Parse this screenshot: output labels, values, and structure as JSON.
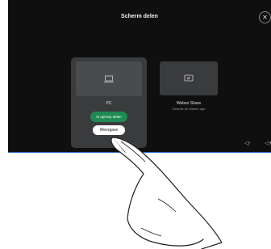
{
  "header": {
    "title": "Scherm delen",
    "close_icon": "close-icon"
  },
  "sources": [
    {
      "label": "PC",
      "subtitle": "",
      "icon": "laptop-icon",
      "selected": true
    },
    {
      "label": "Webex Share",
      "subtitle": "Gebruik de Webex-app",
      "icon": "cast-screen-icon",
      "selected": false
    }
  ],
  "actions": {
    "share_in_call": "In oproep delen",
    "preview": "Weergave"
  },
  "volume": {
    "down_icon": "volume-down-icon",
    "up_icon": "volume-up-icon"
  },
  "colors": {
    "background": "#0f0f10",
    "card": "#3a3b3d",
    "accent_green": "#1f8a54",
    "border_blue": "#2a6ec8"
  }
}
